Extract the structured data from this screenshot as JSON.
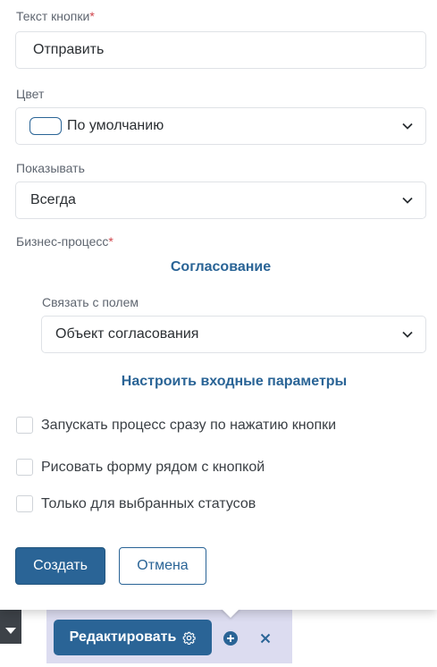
{
  "form": {
    "button_text_label": "Текст кнопки",
    "required_mark": "*",
    "button_text_value": "Отправить",
    "color_label": "Цвет",
    "color_value": "По умолчанию",
    "show_label": "Показывать",
    "show_value": "Всегда",
    "process_label": "Бизнес-процесс",
    "process_link": "Согласование",
    "link_field_label": "Связать с полем",
    "link_field_value": "Объект согласования",
    "configure_params_link": "Настроить входные параметры",
    "checkboxes": [
      {
        "label": "Запускать процесс сразу по нажатию кнопки",
        "checked": false
      },
      {
        "label": "Рисовать форму рядом с кнопкой",
        "checked": false
      },
      {
        "label": "Только для выбранных статусов",
        "checked": false
      }
    ],
    "create_button": "Создать",
    "cancel_button": "Отмена"
  },
  "toolbar": {
    "edit_button": "Редактировать",
    "edit_icon": "gear-icon",
    "add_icon": "plus-circle-icon",
    "close_icon": "close-icon"
  },
  "colors": {
    "accent": "#2a6496",
    "required": "#d0454c",
    "toolbar_bg": "#dcdcf0",
    "dark_tab": "#3d4248"
  }
}
